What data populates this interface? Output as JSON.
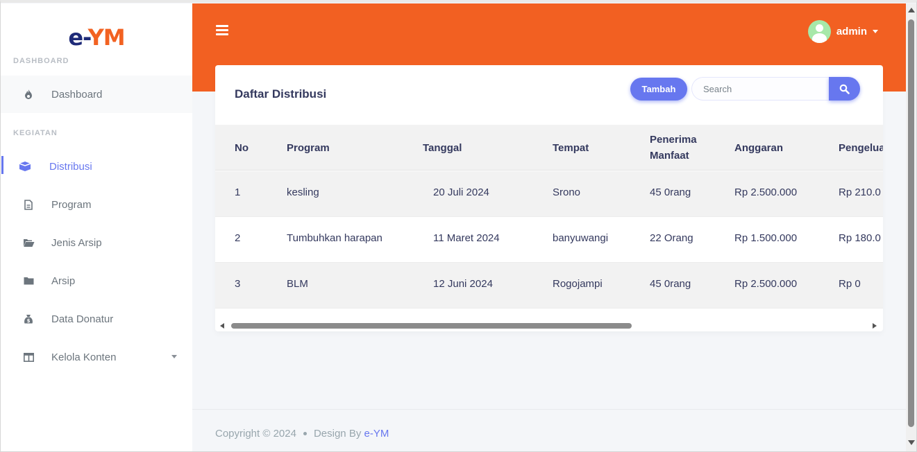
{
  "brand": {
    "part1": "e-",
    "part2": "YM"
  },
  "sidebar": {
    "section_dashboard": "DASHBOARD",
    "section_kegiatan": "KEGIATAN",
    "items": [
      {
        "label": "Dashboard",
        "icon": "fire-icon"
      },
      {
        "label": "Distribusi",
        "icon": "box-icon"
      },
      {
        "label": "Program",
        "icon": "file-icon"
      },
      {
        "label": "Jenis Arsip",
        "icon": "folder-open-icon"
      },
      {
        "label": "Arsip",
        "icon": "folder-icon"
      },
      {
        "label": "Data Donatur",
        "icon": "money-bag-icon"
      },
      {
        "label": "Kelola Konten",
        "icon": "columns-icon"
      }
    ]
  },
  "header": {
    "username": "admin"
  },
  "card": {
    "title": "Daftar Distribusi",
    "add_button": "Tambah",
    "search_placeholder": "Search"
  },
  "table": {
    "columns": [
      "No",
      "Program",
      "Tanggal",
      "Tempat",
      "Penerima",
      "Manfaat",
      "Anggaran",
      "Pengelua"
    ],
    "rows": [
      {
        "no": "1",
        "program": "kesling",
        "tanggal": "20 Juli 2024",
        "tempat": "Srono",
        "penerima": "45 0rang",
        "anggaran": "Rp 2.500.000",
        "pengeluaran": "Rp 210.0"
      },
      {
        "no": "2",
        "program": "Tumbuhkan harapan",
        "tanggal": "11 Maret 2024",
        "tempat": "banyuwangi",
        "penerima": "22 Orang",
        "anggaran": "Rp 1.500.000",
        "pengeluaran": "Rp 180.0"
      },
      {
        "no": "3",
        "program": "BLM",
        "tanggal": "12 Juni 2024",
        "tempat": "Rogojampi",
        "penerima": "45 0rang",
        "anggaran": "Rp 2.500.000",
        "pengeluaran": "Rp 0"
      }
    ]
  },
  "footer": {
    "copyright": "Copyright © 2024",
    "design_by": "Design By",
    "brand_link": "e-YM"
  },
  "colors": {
    "accent": "#6777ef",
    "topbar": "#f26022",
    "brand_dark": "#1e2a78"
  }
}
